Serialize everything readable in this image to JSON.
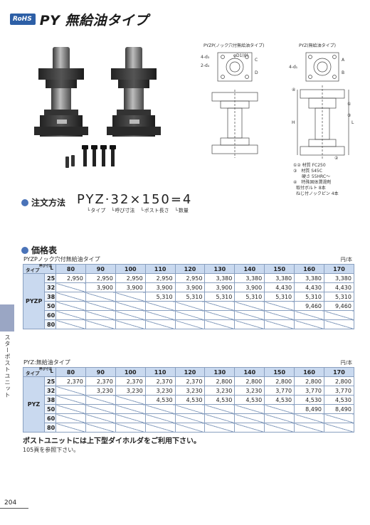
{
  "header": {
    "badge": "RoHS",
    "title": "PY 無給油タイプ"
  },
  "drawings": {
    "pyzp_label": "PYZP(ノック穴付無給油タイプ)",
    "pyz_label": "PYZ(無給油タイプ)",
    "dims": [
      "4-d₃",
      "2-d₄",
      "φD1(0)",
      "C",
      "D",
      "4-d₁",
      "A",
      "B",
      "H",
      "L",
      "①",
      "②",
      "③",
      "④"
    ],
    "notes": [
      "①② 材質 FC250",
      "③　材質 S45C",
      "　　硬さ 55HRC～",
      "④　特殊固体潤滑剤",
      "取付ボルト 8本",
      "ねじ付ノックピン 4本"
    ]
  },
  "order": {
    "heading": "注文方法",
    "code": "PYZ·32×150=4",
    "parts": [
      "タイプ",
      "呼び寸法",
      "ポスト長さ",
      "数量"
    ]
  },
  "price": {
    "heading": "価格表",
    "unit": "円/本",
    "corner_type": "タイプ",
    "corner_d": "呼び寸法",
    "corner_l": "L",
    "columns": [
      "80",
      "90",
      "100",
      "110",
      "120",
      "130",
      "140",
      "150",
      "160",
      "170"
    ],
    "tables": [
      {
        "caption": "PYZPノック穴付無給油タイプ",
        "series": "PYZP",
        "rows": [
          {
            "d": "25",
            "cells": [
              "2,950",
              "2,950",
              "2,950",
              "2,950",
              "2,950",
              "3,380",
              "3,380",
              "3,380",
              "3,380",
              "3,380"
            ]
          },
          {
            "d": "32",
            "cells": [
              "",
              "3,900",
              "3,900",
              "3,900",
              "3,900",
              "3,900",
              "3,900",
              "4,430",
              "4,430",
              "4,430"
            ]
          },
          {
            "d": "38",
            "cells": [
              "",
              "",
              "",
              "5,310",
              "5,310",
              "5,310",
              "5,310",
              "5,310",
              "5,310",
              "5,310"
            ]
          },
          {
            "d": "50",
            "cells": [
              "",
              "",
              "",
              "",
              "",
              "",
              "",
              "",
              "9,460",
              "9,460"
            ]
          },
          {
            "d": "60",
            "cells": [
              "",
              "",
              "",
              "",
              "",
              "",
              "",
              "",
              "",
              ""
            ]
          },
          {
            "d": "80",
            "cells": [
              "",
              "",
              "",
              "",
              "",
              "",
              "",
              "",
              "",
              ""
            ]
          }
        ]
      },
      {
        "caption": "PYZ:無給油タイプ",
        "series": "PYZ",
        "rows": [
          {
            "d": "25",
            "cells": [
              "2,370",
              "2,370",
              "2,370",
              "2,370",
              "2,370",
              "2,800",
              "2,800",
              "2,800",
              "2,800",
              "2,800"
            ]
          },
          {
            "d": "32",
            "cells": [
              "",
              "3,230",
              "3,230",
              "3,230",
              "3,230",
              "3,230",
              "3,230",
              "3,770",
              "3,770",
              "3,770"
            ]
          },
          {
            "d": "38",
            "cells": [
              "",
              "",
              "",
              "4,530",
              "4,530",
              "4,530",
              "4,530",
              "4,530",
              "4,530",
              "4,530"
            ]
          },
          {
            "d": "50",
            "cells": [
              "",
              "",
              "",
              "",
              "",
              "",
              "",
              "",
              "8,490",
              "8,490"
            ]
          },
          {
            "d": "60",
            "cells": [
              "",
              "",
              "",
              "",
              "",
              "",
              "",
              "",
              "",
              ""
            ]
          },
          {
            "d": "80",
            "cells": [
              "",
              "",
              "",
              "",
              "",
              "",
              "",
              "",
              "",
              ""
            ]
          }
        ]
      }
    ]
  },
  "notes": {
    "line1": "ポストユニットには上下型ダイホルダをご利用下さい。",
    "line2": "105頁を参照下さい。"
  },
  "side_label": "スターポストユニット",
  "page_number": "204"
}
